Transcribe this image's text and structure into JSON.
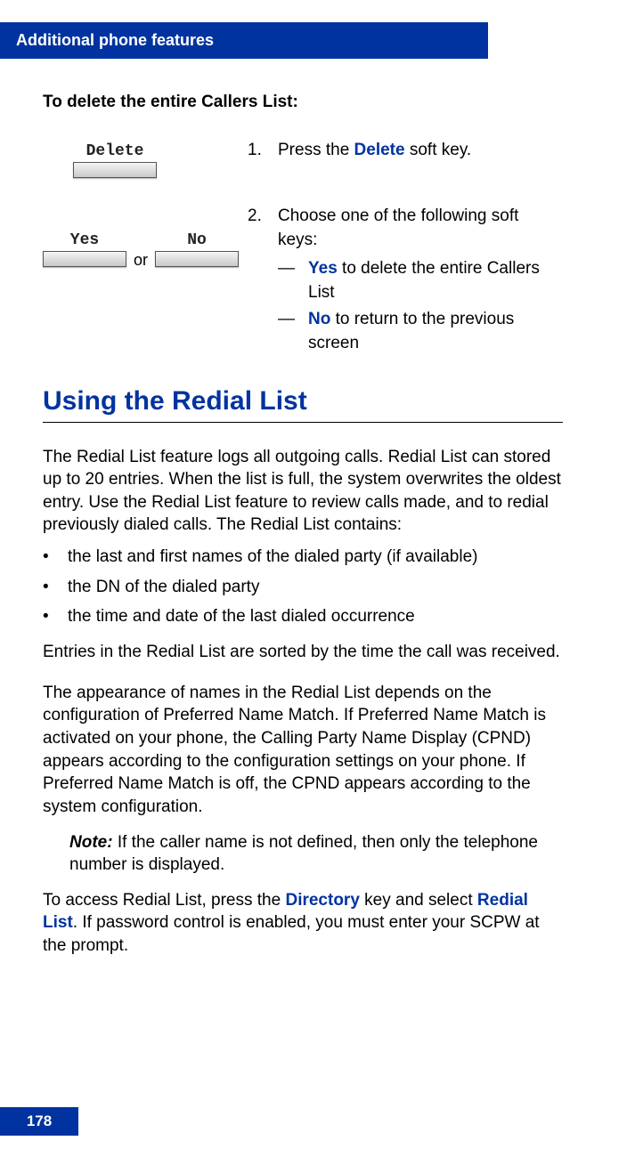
{
  "header": {
    "title": "Additional phone features"
  },
  "instr": {
    "title": "To delete the entire Callers List:",
    "steps": [
      {
        "keys": [
          {
            "label": "Delete"
          }
        ],
        "num": "1.",
        "text_pre": "Press the ",
        "text_hl": "Delete",
        "text_post": " soft key."
      },
      {
        "keys_or": [
          {
            "label": "Yes"
          },
          {
            "label": "No"
          }
        ],
        "or_word": "or",
        "num": "2.",
        "text_plain": "Choose one of the following soft keys:",
        "subs": [
          {
            "dash": "—",
            "hl": "Yes",
            "rest": " to delete the entire Callers List"
          },
          {
            "dash": "—",
            "hl": "No",
            "rest": " to return to the previous screen"
          }
        ]
      }
    ]
  },
  "section": {
    "title": "Using the Redial List",
    "intro": "The Redial List feature logs all outgoing calls. Redial List can stored up to 20 entries. When the list is full, the system overwrites the oldest entry. Use the Redial List feature to review calls made, and to redial previously dialed calls. The Redial List contains:",
    "bullets": [
      "the last and first names of the dialed party (if available)",
      "the DN of the dialed party",
      "the time and date of the last dialed occurrence"
    ],
    "sorted": "Entries in the Redial List are sorted by the time the call was received.",
    "cpnd": "The appearance of names in the Redial List depends on the configuration of Preferred Name Match. If Preferred Name Match is activated on your phone, the Calling Party Name Display (CPND) appears according to the configuration settings on your phone. If Preferred Name Match is off, the CPND appears according to the system configuration.",
    "note_label": "Note:",
    "note_text": " If the caller name is not defined, then only the telephone number is displayed.",
    "access_1": "To access Redial List, press the ",
    "access_hl1": "Directory",
    "access_2": " key and select ",
    "access_hl2": "Redial List",
    "access_3": ". If password control is enabled, you must enter your SCPW at the prompt."
  },
  "page_number": "178",
  "bullet_char": "•"
}
